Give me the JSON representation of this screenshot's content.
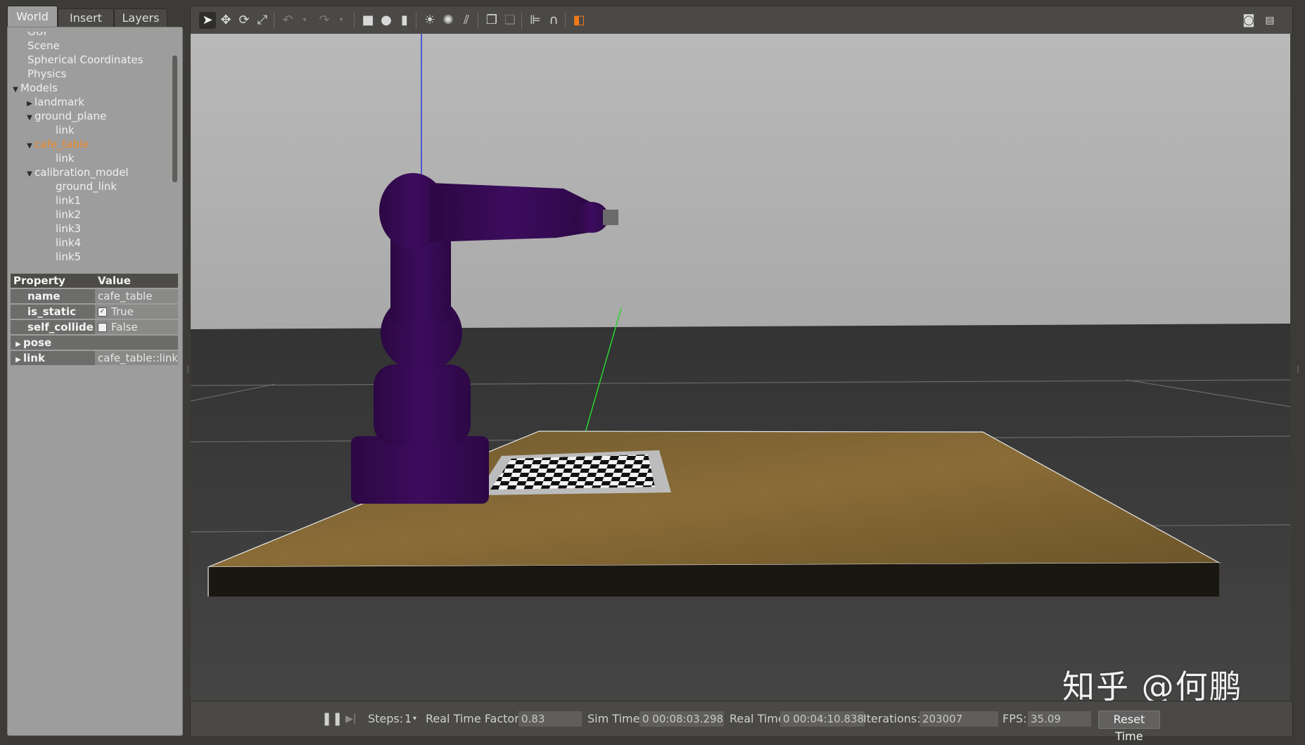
{
  "left_panel": {
    "tabs": [
      "World",
      "Insert",
      "Layers"
    ],
    "active_tab": "World",
    "tree": {
      "gui": "GUI",
      "scene": "Scene",
      "spherical": "Spherical Coordinates",
      "physics": "Physics",
      "models": "Models",
      "landmark": "landmark",
      "ground_plane": "ground_plane",
      "ground_plane_link": "link",
      "cafe_table": "cafe_table",
      "cafe_table_link": "link",
      "calibration_model": "calibration_model",
      "ground_link": "ground_link",
      "link1": "link1",
      "link2": "link2",
      "link3": "link3",
      "link4": "link4",
      "link5": "link5",
      "selected": "cafe_table"
    },
    "properties": {
      "header_property": "Property",
      "header_value": "Value",
      "name_label": "name",
      "name_value": "cafe_table",
      "is_static_label": "is_static",
      "is_static_value": "True",
      "self_collide_label": "self_collide",
      "self_collide_value": "False",
      "pose_label": "pose",
      "link_label": "link",
      "link_value": "cafe_table::link"
    }
  },
  "toolbar": {
    "icons": [
      "select-arrow-icon",
      "translate-icon",
      "rotate-icon",
      "scale-icon",
      "undo-icon",
      "undo-history-icon",
      "redo-icon",
      "redo-history-icon",
      "box-icon",
      "sphere-icon",
      "cylinder-icon",
      "point-light-icon",
      "spot-light-icon",
      "directional-light-icon",
      "copy-icon",
      "paste-icon",
      "align-icon",
      "snap-icon",
      "view-angle-icon",
      "screenshot-icon",
      "log-icon"
    ]
  },
  "bottom_bar": {
    "steps_label": "Steps:",
    "steps_value": "1",
    "rtf_label": "Real Time Factor:",
    "rtf_value": "0.83",
    "sim_time_label": "Sim Time:",
    "sim_time_value": "0 00:08:03.298",
    "real_time_label": "Real Time:",
    "real_time_value": "0 00:04:10.838",
    "iterations_label": "Iterations:",
    "iterations_value": "203007",
    "fps_label": "FPS:",
    "fps_value": "35.09",
    "reset_label": "Reset Time"
  },
  "watermark": "知乎 @何鹏",
  "colors": {
    "robot": "#3a0a5a",
    "table": "#7d6230",
    "sky": "#b4b4b4",
    "ground": "#3a3a3a",
    "selected": "#f08c2a"
  }
}
